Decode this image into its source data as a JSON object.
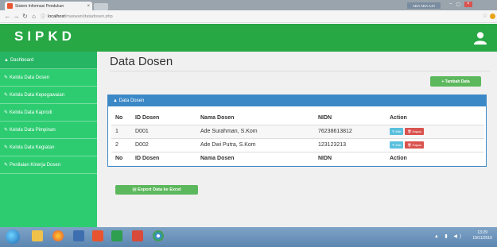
{
  "browser": {
    "tab_title": "Sistem Informasi Pendukun",
    "tab_close": "×",
    "user_badge": "ADA ADA AJA",
    "win_controls": [
      "–",
      "▢",
      "×"
    ],
    "url_host": "localhost",
    "url_path": "/maswan/datadosen.php",
    "nav": {
      "back": "←",
      "forward": "→",
      "reload": "↻",
      "home": "⌂",
      "info": "ⓘ"
    },
    "star": "☆"
  },
  "app": {
    "brand": "SIPKD",
    "header_color": "#28a745",
    "sidebar_color": "#2ecc71"
  },
  "sidebar": {
    "items": [
      {
        "icon": "▲",
        "label": "Dashboard"
      },
      {
        "icon": "✎",
        "label": "Kelola Data Dosen"
      },
      {
        "icon": "✎",
        "label": "Kelola Data Kepegawaian"
      },
      {
        "icon": "✎",
        "label": "Kelola Data Kaprodi"
      },
      {
        "icon": "✎",
        "label": "Kelola Data Pimpinan"
      },
      {
        "icon": "✎",
        "label": "Kelola Data Kegiatan"
      },
      {
        "icon": "✎",
        "label": "Penilaian Kinerja Dosen"
      }
    ]
  },
  "main": {
    "title": "Data Dosen",
    "add_button": "+ Tambah Data",
    "panel_title": "▲ Data Dosen",
    "export_button": "▤ Export Data ke Excel",
    "table": {
      "headers": [
        "No",
        "ID Dosen",
        "Nama Dosen",
        "NIDN",
        "Action"
      ],
      "rows": [
        {
          "no": "1",
          "id": "D001",
          "nama": "Ade Surahman, S.Kom",
          "nidn": "76238613812"
        },
        {
          "no": "2",
          "id": "D002",
          "nama": "Ade Dwi Putra, S.Kom",
          "nidn": "123123213"
        }
      ],
      "edit_label": "✎ Edit",
      "delete_label": "🗑 Hapus"
    }
  },
  "taskbar": {
    "tray": "▲ ▮ ◀)",
    "time": "13:29",
    "date": "19/11/2016"
  }
}
